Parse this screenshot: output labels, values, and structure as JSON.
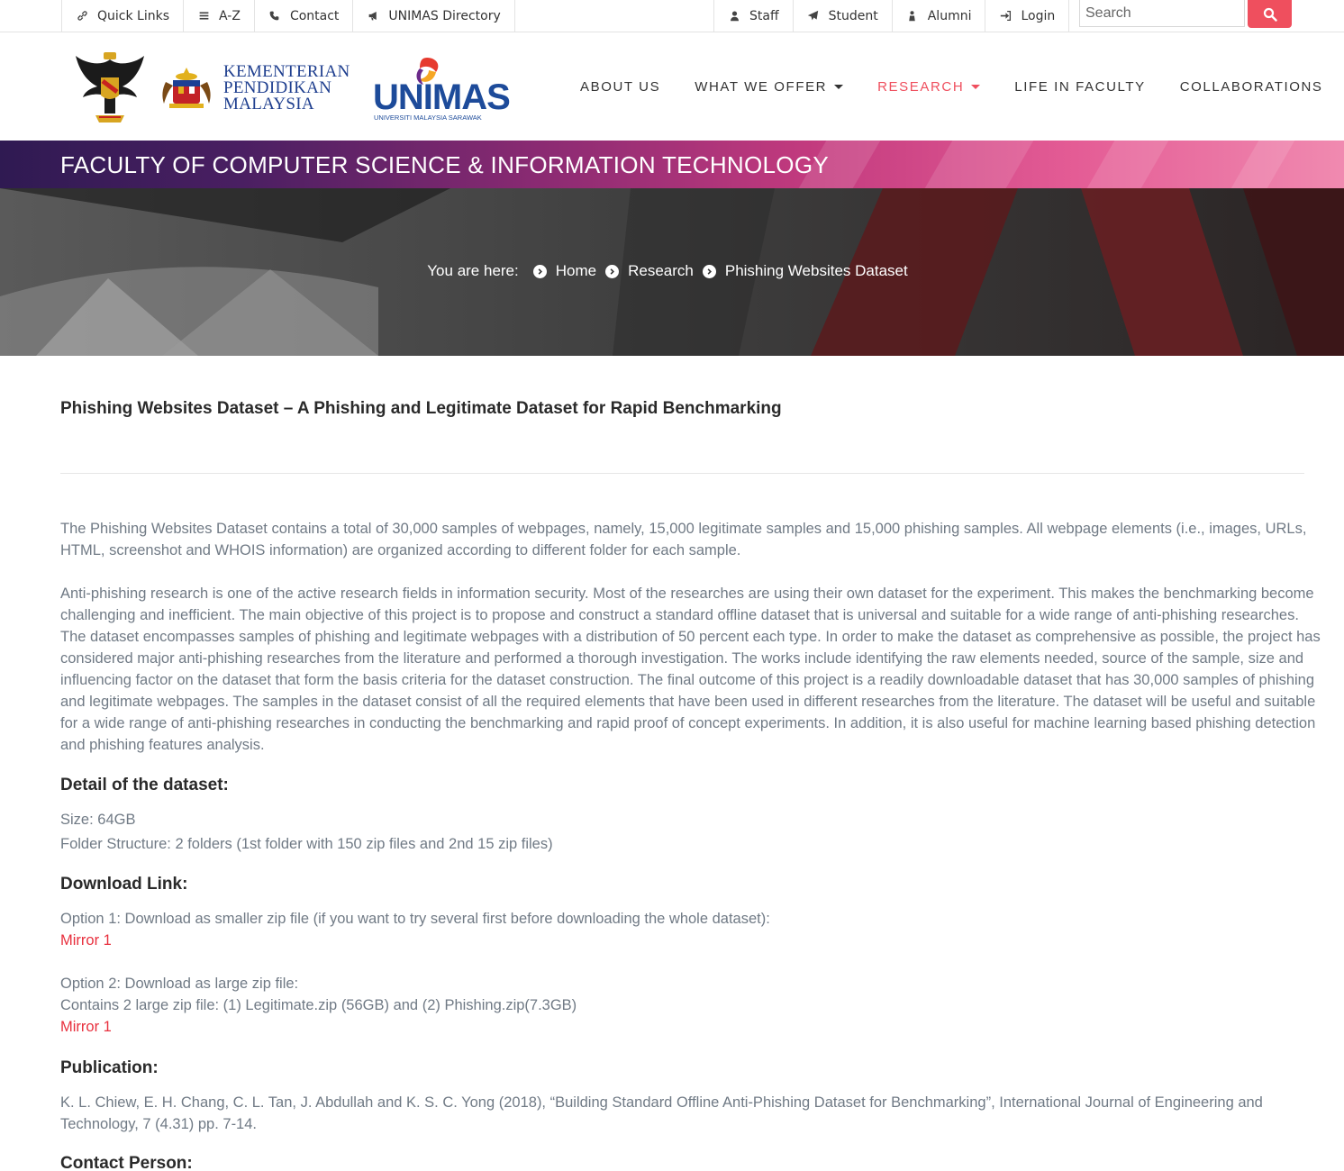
{
  "topbar": {
    "left_links": [
      {
        "label": "Quick Links",
        "icon": "link-icon"
      },
      {
        "label": "A-Z",
        "icon": "list-icon"
      },
      {
        "label": "Contact",
        "icon": "phone-icon"
      },
      {
        "label": "UNIMAS Directory",
        "icon": "bullhorn-icon"
      }
    ],
    "right_links": [
      {
        "label": "Staff",
        "icon": "user-icon"
      },
      {
        "label": "Student",
        "icon": "paper-plane-icon"
      },
      {
        "label": "Alumni",
        "icon": "graduate-icon"
      },
      {
        "label": "Login",
        "icon": "sign-in-icon"
      }
    ],
    "search_placeholder": "Search"
  },
  "logos": {
    "ministry_line1": "KEMENTERIAN",
    "ministry_line2": "PENDIDIKAN",
    "ministry_line3": "MALAYSIA",
    "unimas": "UNIMAS",
    "unimas_sub": "UNIVERSITI MALAYSIA SARAWAK"
  },
  "nav": {
    "items": [
      {
        "label": "ABOUT US",
        "dropdown": false,
        "active": false
      },
      {
        "label": "WHAT WE OFFER",
        "dropdown": true,
        "active": false
      },
      {
        "label": "RESEARCH",
        "dropdown": true,
        "active": true
      },
      {
        "label": "LIFE IN FACULTY",
        "dropdown": false,
        "active": false
      },
      {
        "label": "COLLABORATIONS",
        "dropdown": false,
        "active": false
      }
    ]
  },
  "banner": {
    "title": "FACULTY OF COMPUTER SCIENCE & INFORMATION TECHNOLOGY"
  },
  "breadcrumb": {
    "label": "You are here:",
    "items": [
      "Home",
      "Research",
      "Phishing Websites Dataset"
    ]
  },
  "main": {
    "title": "Phishing Websites Dataset – A Phishing and Legitimate Dataset for Rapid Benchmarking",
    "intro": "The Phishing Websites Dataset contains a total of 30,000 samples of webpages, namely, 15,000 legitimate samples and 15,000 phishing samples. All webpage elements (i.e., images, URLs, HTML, screenshot and WHOIS information) are organized according to different folder for each sample.",
    "description": "Anti-phishing research is one of the active research fields in information security. Most of the researches are using their own dataset for the experiment. This makes the benchmarking become challenging and inefficient. The main objective of this project is to propose and construct a standard offline dataset that is universal and suitable for a wide range of anti-phishing researches. The dataset encompasses samples of phishing and legitimate webpages with a distribution of 50 percent each type. In order to make the dataset as comprehensive as possible, the project has considered major anti-phishing researches from the literature and performed a thorough investigation. The works include identifying the raw elements needed, source of the sample, size and influencing factor on the dataset that form the basis criteria for the dataset construction. The final outcome of this project is a readily downloadable dataset that has 30,000 samples of phishing and legitimate webpages. The samples in the dataset consist of all the required elements that have been used in different researches from the literature. The dataset will be useful and suitable for a wide range of anti-phishing researches in conducting the benchmarking and rapid proof of concept experiments. In addition, it is also useful for machine learning based phishing detection and phishing features analysis.",
    "detail_heading": "Detail of the dataset:",
    "size": "Size: 64GB",
    "folder_structure": "Folder Structure: 2 folders (1st folder with 150 zip files and 2nd 15 zip files)",
    "download_heading": "Download Link:",
    "option1": "Option 1: Download as smaller zip file (if you want to try several first before downloading the whole dataset):",
    "option1_link": "Mirror 1",
    "option2": "Option 2: Download as large zip file:",
    "option2_detail": "Contains 2 large zip file: (1) Legitimate.zip (56GB) and (2) Phishing.zip(7.3GB)",
    "option2_link": "Mirror 1",
    "publication_heading": "Publication:",
    "publication": "K. L. Chiew, E. H. Chang, C. L. Tan, J. Abdullah and K. S. C. Yong (2018), “Building Standard Offline Anti-Phishing Dataset for Benchmarking”, International Journal of Engineering and Technology, 7 (4.31) pp. 7-14.",
    "contact_heading": "Contact Person:"
  },
  "colors": {
    "accent": "#ef4f5e",
    "link": "#e8303e",
    "body_text": "#707a85"
  }
}
